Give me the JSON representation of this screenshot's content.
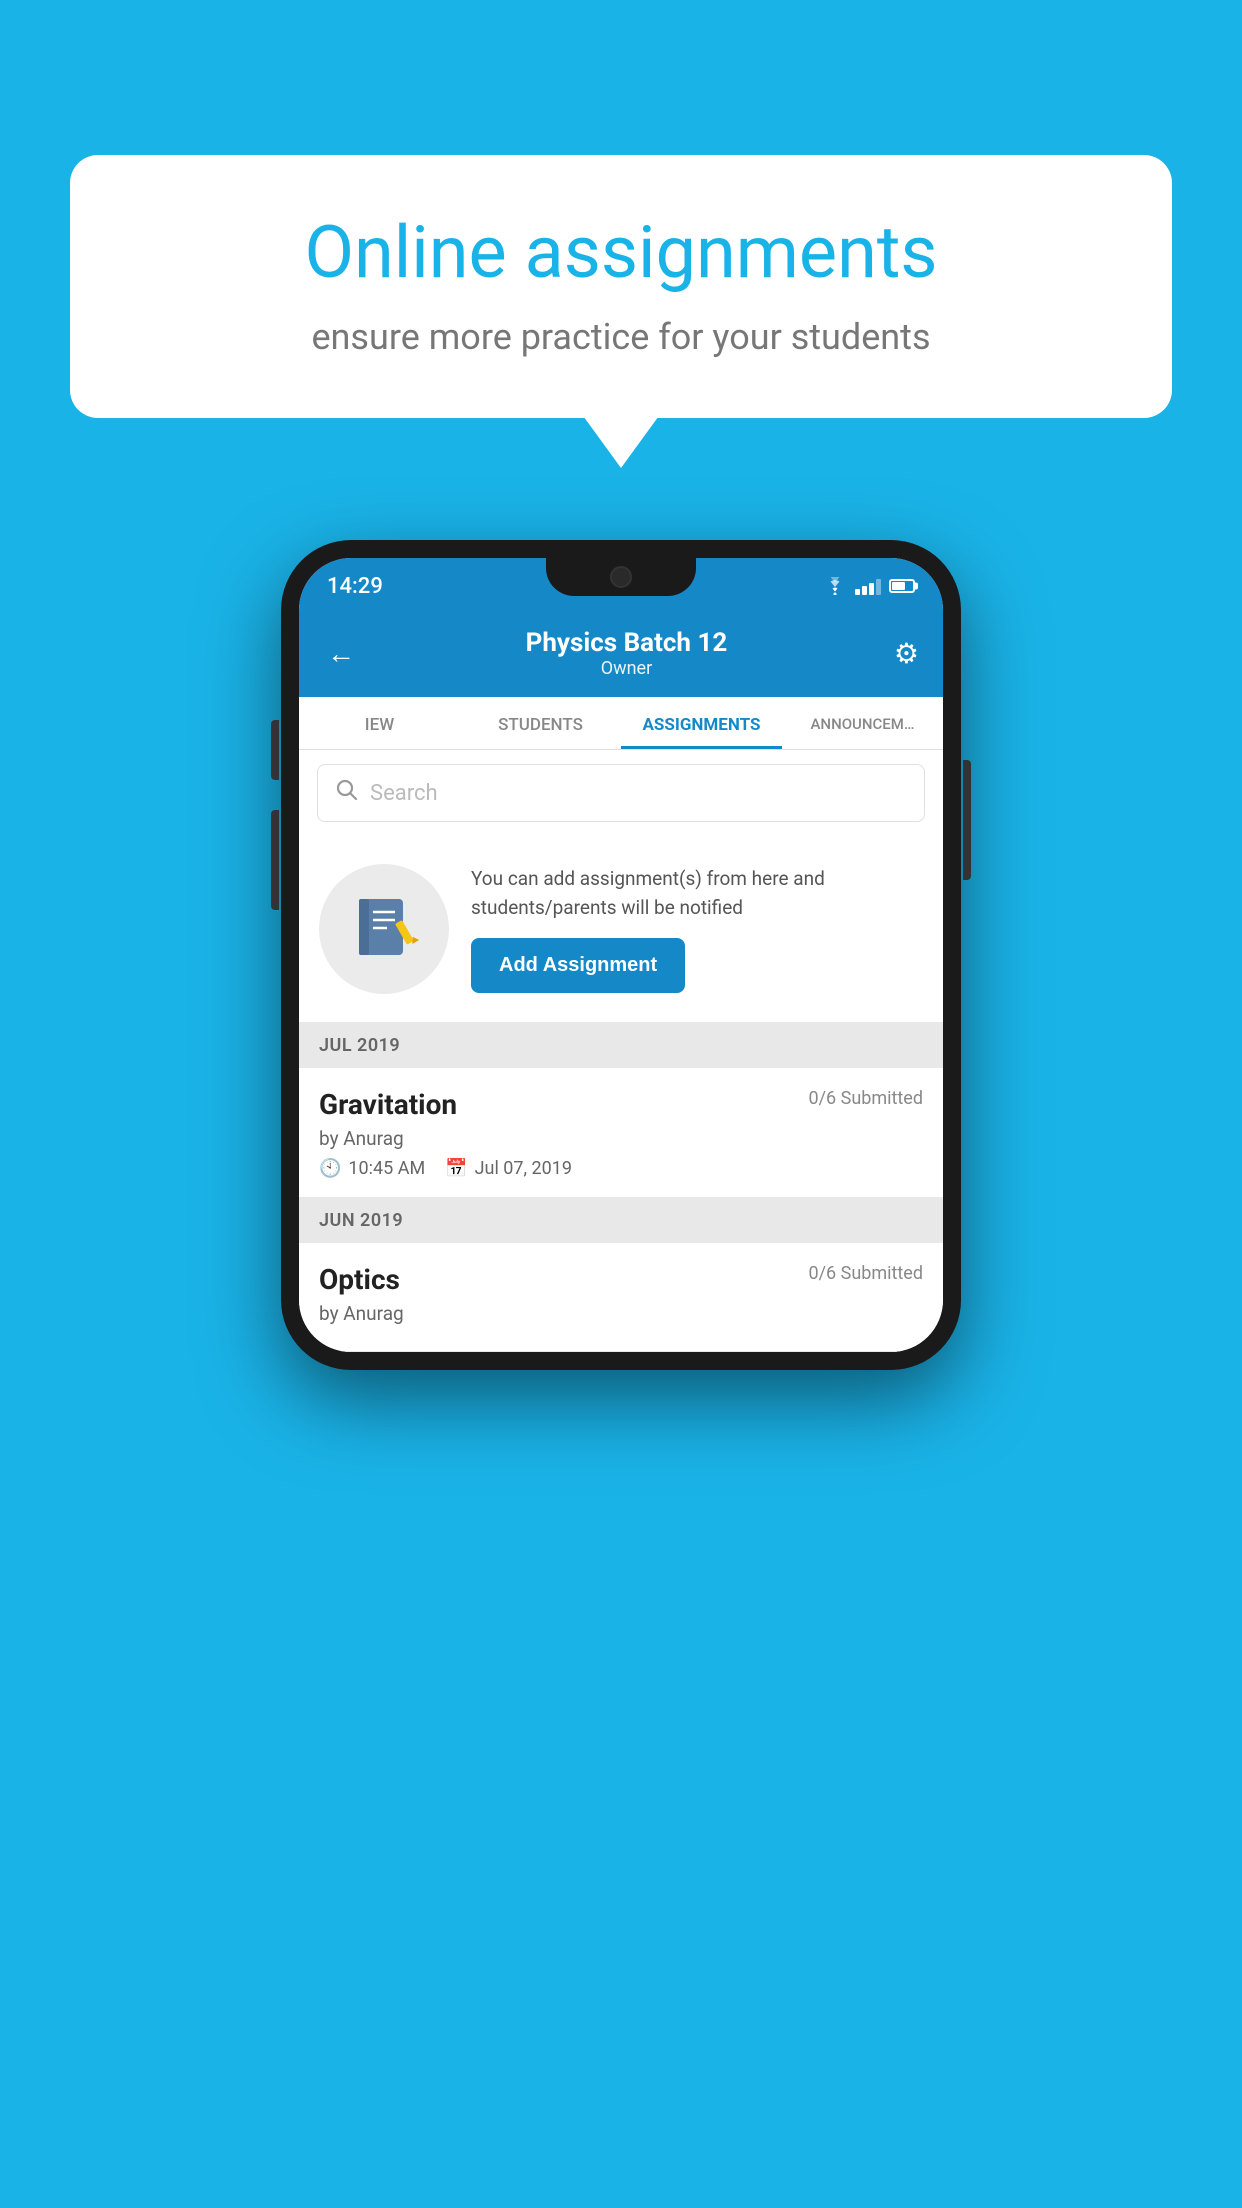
{
  "background_color": "#1ab3e8",
  "speech_bubble": {
    "title": "Online assignments",
    "subtitle": "ensure more practice for your students"
  },
  "phone": {
    "status_bar": {
      "time": "14:29"
    },
    "header": {
      "title": "Physics Batch 12",
      "subtitle": "Owner",
      "back_label": "←",
      "settings_label": "⚙"
    },
    "tabs": [
      {
        "label": "IEW",
        "active": false
      },
      {
        "label": "STUDENTS",
        "active": false
      },
      {
        "label": "ASSIGNMENTS",
        "active": true
      },
      {
        "label": "ANNOUNCEM…",
        "active": false
      }
    ],
    "search": {
      "placeholder": "Search"
    },
    "promo": {
      "text": "You can add assignment(s) from here and students/parents will be notified",
      "button_label": "Add Assignment"
    },
    "sections": [
      {
        "label": "JUL 2019",
        "assignments": [
          {
            "name": "Gravitation",
            "submitted": "0/6 Submitted",
            "by": "by Anurag",
            "time": "10:45 AM",
            "date": "Jul 07, 2019"
          }
        ]
      },
      {
        "label": "JUN 2019",
        "assignments": [
          {
            "name": "Optics",
            "submitted": "0/6 Submitted",
            "by": "by Anurag",
            "time": "",
            "date": ""
          }
        ]
      }
    ]
  }
}
